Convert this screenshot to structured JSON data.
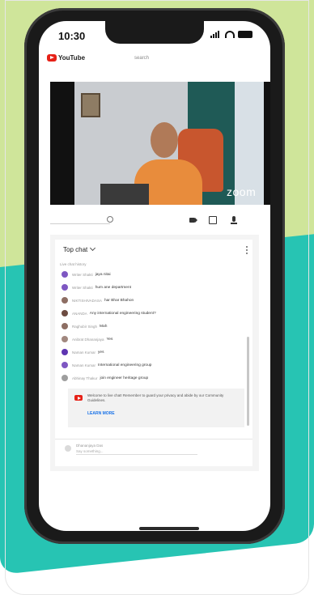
{
  "status_bar": {
    "time": "10:30"
  },
  "youtube_bar": {
    "logo_text": "YouTube",
    "center_text": "search"
  },
  "video": {
    "watermark": "zoom"
  },
  "chat": {
    "header": "Top chat",
    "partial_text": "Live chat history",
    "messages": [
      {
        "author": "Writer Shakti",
        "text": "jaya nitai",
        "color": "#7e57c2"
      },
      {
        "author": "Writer Shakti",
        "text": "hum ane department",
        "color": "#7e57c2"
      },
      {
        "author": "NIKTISHIVADASA",
        "text": "har Bhar Bhahon",
        "color": "#8d6e63"
      },
      {
        "author": "ANANDA",
        "text": "Any international engineering student?",
        "color": "#6d4c41"
      },
      {
        "author": "Raghubir Singh",
        "text": "Mah",
        "color": "#8d6e63"
      },
      {
        "author": "Anibrat Dhananjaya",
        "text": "Yes",
        "color": "#a1887f"
      },
      {
        "author": "Naman Kumar",
        "text": "yes",
        "color": "#5e35b1"
      },
      {
        "author": "Naman Kumar",
        "text": "International engineering group",
        "color": "#7e57c2"
      },
      {
        "author": "Abhinay Thakur",
        "text": "join engineer heritage group",
        "color": "#9e9e9e"
      }
    ],
    "notice_text": "Welcome to live chat! Remember to guard your privacy and abide by our Community Guidelines.",
    "learn_more": "LEARN MORE",
    "input_name": "Dhananjaya Das",
    "input_placeholder": "Say something..."
  }
}
